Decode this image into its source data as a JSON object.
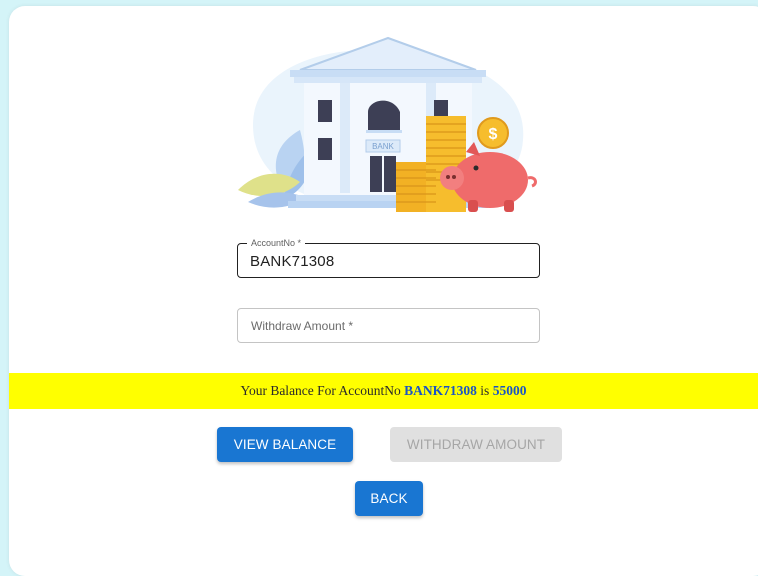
{
  "form": {
    "account_label": "AccountNo *",
    "account_value": "BANK71308",
    "amount_placeholder": "Withdraw Amount *"
  },
  "illustration": {
    "bank_sign": "BANK",
    "coin_symbol": "$"
  },
  "balance": {
    "prefix": "Your Balance For AccountNo ",
    "account": "BANK71308",
    "middle": " is ",
    "amount": "55000"
  },
  "buttons": {
    "view_balance": "VIEW BALANCE",
    "withdraw_amount": "WITHDRAW AMOUNT",
    "back": "BACK"
  },
  "colors": {
    "primary": "#1976d2",
    "banner": "#ffff00",
    "highlight": "#1a54c4",
    "page_bg": "#d4f4f8"
  }
}
